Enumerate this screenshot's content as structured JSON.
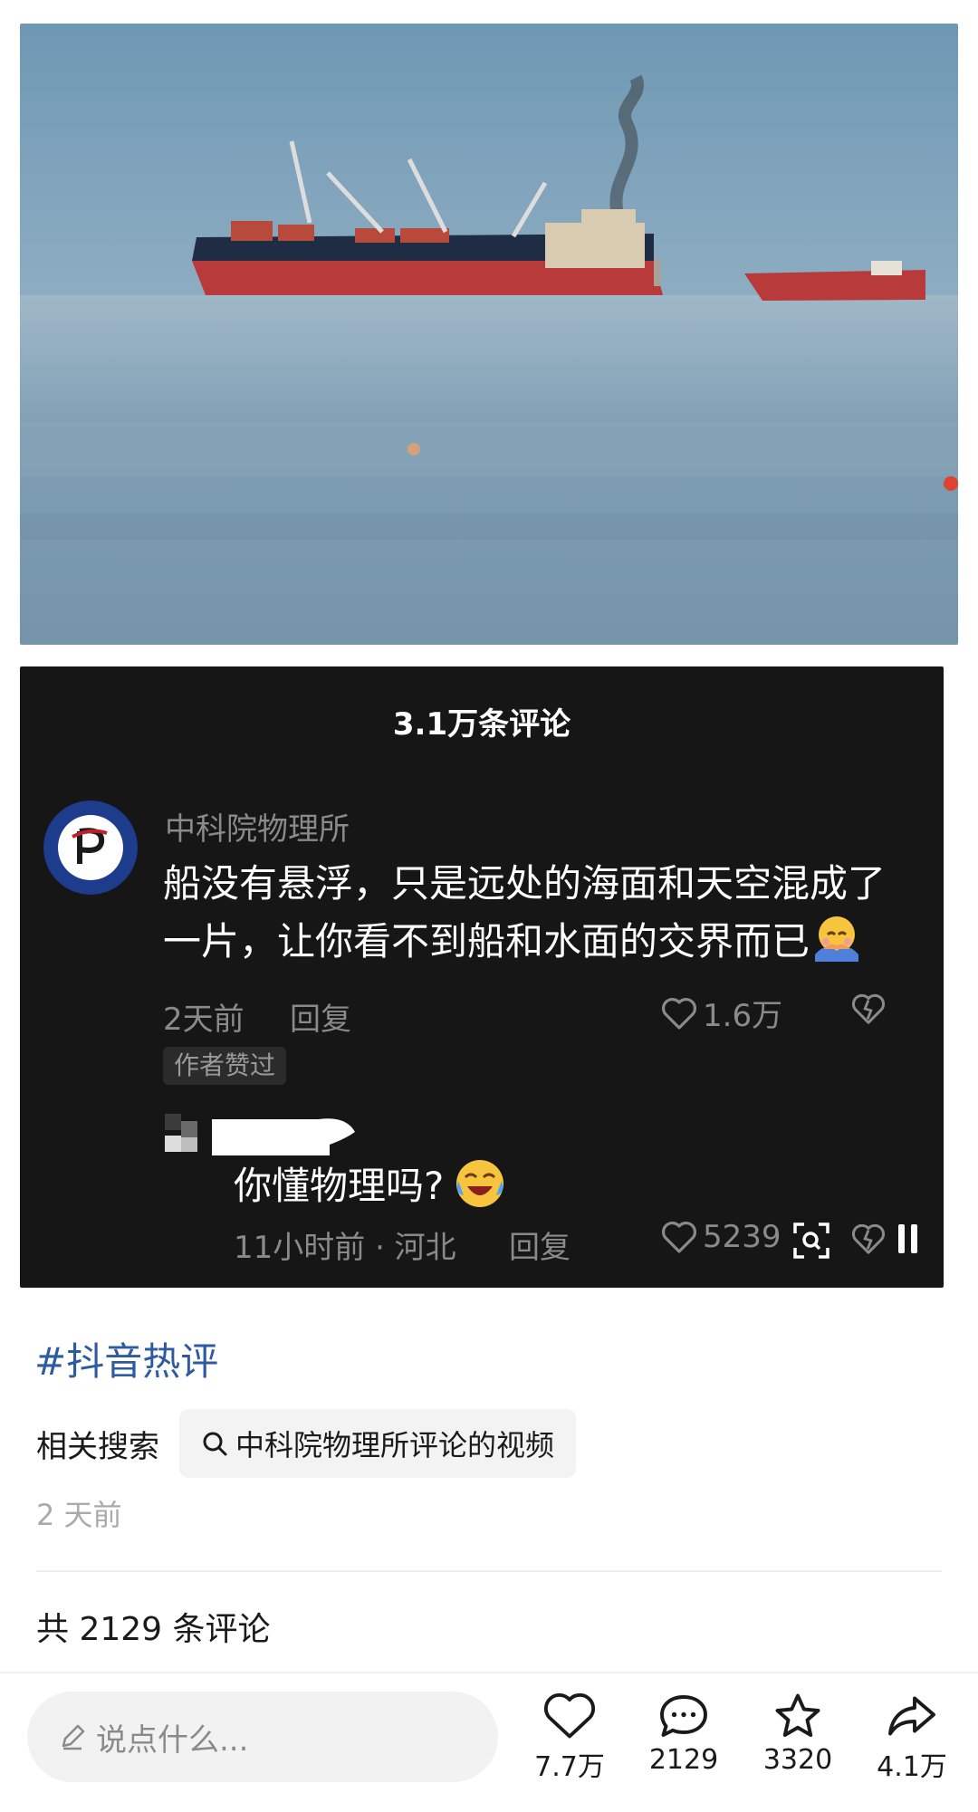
{
  "panel": {
    "title": "3.1万条评论",
    "comment": {
      "author": "中科院物理所",
      "text_line1": "船没有悬浮，只是远处的海面和天空混成了",
      "text_line2": "一片，让你看不到船和水面的交界而已",
      "time": "2天前",
      "reply": "回复",
      "likes": "1.6万",
      "author_liked_badge": "作者赞过"
    },
    "reply_comment": {
      "text": "你懂物理吗?",
      "time": "11小时前 · 河北",
      "reply": "回复",
      "likes": "5239"
    }
  },
  "hashtag": "#抖音热评",
  "related": {
    "label": "相关搜索",
    "query": "中科院物理所评论的视频"
  },
  "post_time": "2 天前",
  "comment_count": "共 2129 条评论",
  "bottom_bar": {
    "input_placeholder": "说点什么...",
    "likes": "7.7万",
    "comments": "2129",
    "favorites": "3320",
    "shares": "4.1万"
  },
  "colors": {
    "hashtag": "#2e5aa0",
    "panel_bg": "#161616",
    "ship_hull": "#b83a3a"
  }
}
